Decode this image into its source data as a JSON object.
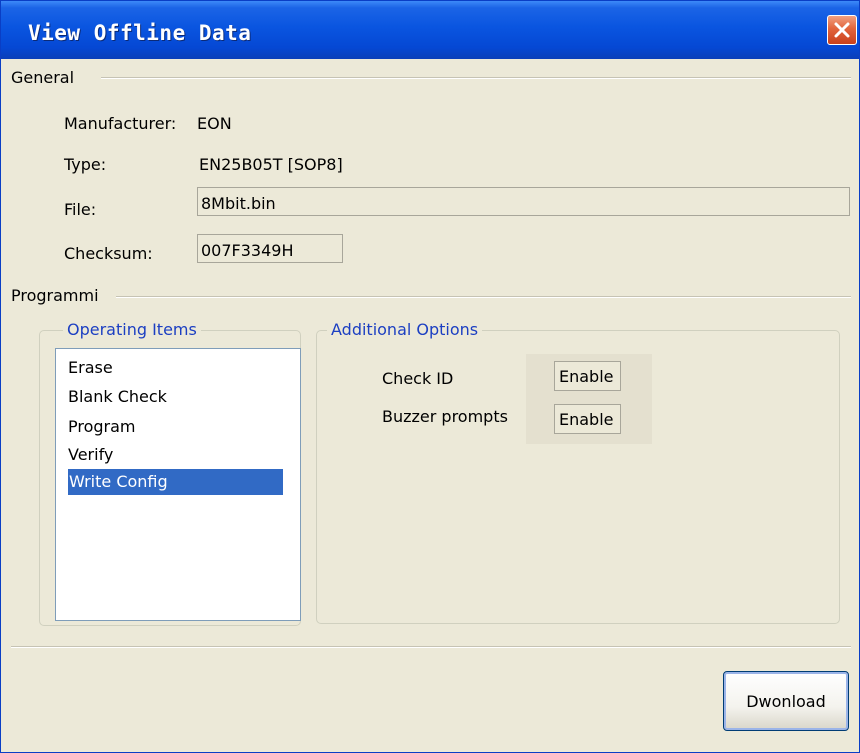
{
  "window": {
    "title": "View Offline Data"
  },
  "general": {
    "group_label": "General",
    "manufacturer_label": "Manufacturer:",
    "manufacturer_value": "EON",
    "type_label": "Type:",
    "type_value": "EN25B05T [SOP8]",
    "file_label": "File:",
    "file_value": "8Mbit.bin",
    "checksum_label": "Checksum:",
    "checksum_value": "007F3349H"
  },
  "programming": {
    "group_label": "Programmi",
    "operating_items": {
      "title": "Operating Items",
      "items": [
        "Erase",
        "Blank Check",
        "Program",
        "Verify",
        "Write Config"
      ],
      "selected": "Write Config"
    },
    "additional_options": {
      "title": "Additional Options",
      "options": [
        {
          "label": "Check ID",
          "value": "Enable"
        },
        {
          "label": "Buzzer prompts",
          "value": "Enable"
        }
      ]
    }
  },
  "footer": {
    "download_label": "Dwonload"
  },
  "colors": {
    "titlebar": "#0a55e0",
    "selection": "#316ac5",
    "group_title": "#1c3fc2",
    "dialog_bg": "#ece9d8"
  }
}
